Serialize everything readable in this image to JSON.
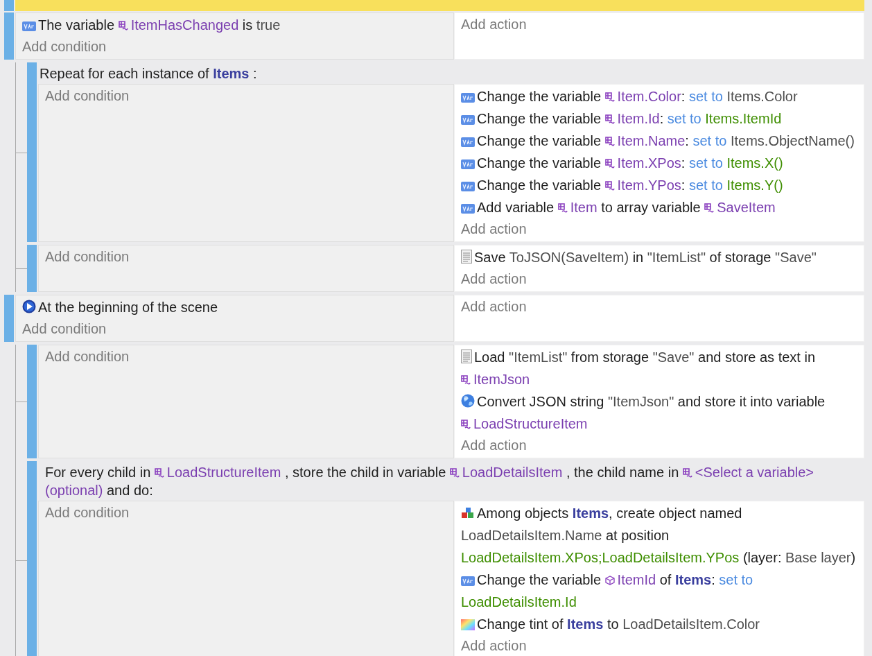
{
  "scrolled_event": {
    "highlighted": true
  },
  "events": [
    {
      "kind": "standard",
      "conditions": [
        {
          "kind": "variable",
          "parts": [
            {
              "kind": "text",
              "text": "The variable"
            },
            {
              "kind": "variable",
              "text": "ItemHasChanged"
            },
            {
              "kind": "text",
              "text": "is"
            },
            {
              "kind": "param",
              "text": "true"
            }
          ]
        }
      ],
      "add_condition": "Add condition",
      "add_action": "Add action",
      "children": [
        {
          "kind": "repeat",
          "header": [
            {
              "kind": "text",
              "text": "Repeat for each instance of"
            },
            {
              "kind": "object",
              "text": "Items"
            },
            {
              "kind": "text",
              "text": ":"
            }
          ],
          "add_condition": "Add condition",
          "actions": [
            {
              "kind": "variable",
              "parts": [
                {
                  "kind": "text",
                  "text": "Change the variable"
                },
                {
                  "kind": "variable",
                  "text": "Item.Color"
                },
                {
                  "kind": "punct",
                  "text": ":"
                },
                {
                  "kind": "operator",
                  "text": "set to"
                },
                {
                  "kind": "param",
                  "text": "Items.Color"
                }
              ]
            },
            {
              "kind": "variable",
              "parts": [
                {
                  "kind": "text",
                  "text": "Change the variable"
                },
                {
                  "kind": "variable",
                  "text": "Item.Id"
                },
                {
                  "kind": "punct",
                  "text": ":"
                },
                {
                  "kind": "operator",
                  "text": "set to"
                },
                {
                  "kind": "expression",
                  "text": "Items.ItemId"
                }
              ]
            },
            {
              "kind": "variable",
              "parts": [
                {
                  "kind": "text",
                  "text": "Change the variable"
                },
                {
                  "kind": "variable",
                  "text": "Item.Name"
                },
                {
                  "kind": "punct",
                  "text": ":"
                },
                {
                  "kind": "operator",
                  "text": "set to"
                },
                {
                  "kind": "param",
                  "text": "Items.ObjectName()"
                }
              ]
            },
            {
              "kind": "variable",
              "parts": [
                {
                  "kind": "text",
                  "text": "Change the variable"
                },
                {
                  "kind": "variable",
                  "text": "Item.XPos"
                },
                {
                  "kind": "punct",
                  "text": ":"
                },
                {
                  "kind": "operator",
                  "text": "set to"
                },
                {
                  "kind": "expression",
                  "text": "Items.X()"
                }
              ]
            },
            {
              "kind": "variable",
              "parts": [
                {
                  "kind": "text",
                  "text": "Change the variable"
                },
                {
                  "kind": "variable",
                  "text": "Item.YPos"
                },
                {
                  "kind": "punct",
                  "text": ":"
                },
                {
                  "kind": "operator",
                  "text": "set to"
                },
                {
                  "kind": "expression",
                  "text": "Items.Y()"
                }
              ]
            },
            {
              "kind": "variable",
              "parts": [
                {
                  "kind": "text",
                  "text": "Add variable"
                },
                {
                  "kind": "variable",
                  "text": "Item"
                },
                {
                  "kind": "text",
                  "text": "to array variable"
                },
                {
                  "kind": "variable",
                  "text": "SaveItem"
                }
              ]
            }
          ],
          "add_action": "Add action"
        },
        {
          "kind": "standard",
          "add_condition": "Add condition",
          "actions": [
            {
              "kind": "storage",
              "parts": [
                {
                  "kind": "text",
                  "text": "Save"
                },
                {
                  "kind": "param",
                  "text": "ToJSON(SaveItem)"
                },
                {
                  "kind": "text",
                  "text": "in"
                },
                {
                  "kind": "param",
                  "text": "\"ItemList\""
                },
                {
                  "kind": "text",
                  "text": "of storage"
                },
                {
                  "kind": "param",
                  "text": "\"Save\""
                }
              ]
            }
          ],
          "add_action": "Add action"
        }
      ]
    },
    {
      "kind": "standard",
      "conditions": [
        {
          "kind": "scene_start",
          "parts": [
            {
              "kind": "text",
              "text": "At the beginning of the scene"
            }
          ]
        }
      ],
      "add_condition": "Add condition",
      "add_action": "Add action",
      "children": [
        {
          "kind": "standard",
          "add_condition": "Add condition",
          "actions": [
            {
              "kind": "storage",
              "parts": [
                {
                  "kind": "text",
                  "text": "Load"
                },
                {
                  "kind": "param",
                  "text": "\"ItemList\""
                },
                {
                  "kind": "text",
                  "text": "from storage"
                },
                {
                  "kind": "param",
                  "text": "\"Save\""
                },
                {
                  "kind": "text",
                  "text": "and store as text in"
                },
                {
                  "kind": "variable",
                  "text": "ItemJson"
                }
              ]
            },
            {
              "kind": "json",
              "parts": [
                {
                  "kind": "text",
                  "text": "Convert JSON string"
                },
                {
                  "kind": "param",
                  "text": "\"ItemJson\""
                },
                {
                  "kind": "text",
                  "text": "and store it into variable"
                },
                {
                  "kind": "variable",
                  "text": "LoadStructureItem"
                }
              ]
            }
          ],
          "add_action": "Add action"
        },
        {
          "kind": "for_each_child",
          "header": [
            {
              "kind": "text",
              "text": "For every child in"
            },
            {
              "kind": "variable",
              "text": "LoadStructureItem"
            },
            {
              "kind": "text",
              "text": ", store the child in variable"
            },
            {
              "kind": "variable",
              "text": "LoadDetailsItem"
            },
            {
              "kind": "text",
              "text": ", the child name in"
            },
            {
              "kind": "variable",
              "text": "<Select a variable>"
            },
            {
              "kind": "hint",
              "text": "(optional)"
            },
            {
              "kind": "text",
              "text": "and do:"
            }
          ],
          "add_condition": "Add condition",
          "actions": [
            {
              "kind": "create",
              "parts": [
                {
                  "kind": "text",
                  "text": "Among objects"
                },
                {
                  "kind": "object",
                  "text": "Items"
                },
                {
                  "kind": "punct",
                  "text": ","
                },
                {
                  "kind": "text",
                  "text": "create object named"
                },
                {
                  "kind": "param",
                  "text": "LoadDetailsItem.Name"
                },
                {
                  "kind": "text",
                  "text": "at position"
                },
                {
                  "kind": "expression",
                  "text": "LoadDetailsItem.XPos;LoadDetailsItem.YPos"
                },
                {
                  "kind": "text",
                  "text": "(layer:"
                },
                {
                  "kind": "param",
                  "text": "Base layer"
                },
                {
                  "kind": "punct",
                  "text": ")"
                }
              ]
            },
            {
              "kind": "variable",
              "parts": [
                {
                  "kind": "text",
                  "text": "Change the variable"
                },
                {
                  "kind": "object_variable",
                  "text": "ItemId"
                },
                {
                  "kind": "text",
                  "text": "of"
                },
                {
                  "kind": "object",
                  "text": "Items"
                },
                {
                  "kind": "punct",
                  "text": ":"
                },
                {
                  "kind": "operator",
                  "text": "set to"
                },
                {
                  "kind": "expression",
                  "text": "LoadDetailsItem.Id"
                }
              ]
            },
            {
              "kind": "tint",
              "parts": [
                {
                  "kind": "text",
                  "text": "Change tint of"
                },
                {
                  "kind": "object",
                  "text": "Items"
                },
                {
                  "kind": "text",
                  "text": "to"
                },
                {
                  "kind": "param",
                  "text": "LoadDetailsItem.Color"
                }
              ]
            }
          ],
          "add_action": "Add action"
        }
      ]
    }
  ]
}
